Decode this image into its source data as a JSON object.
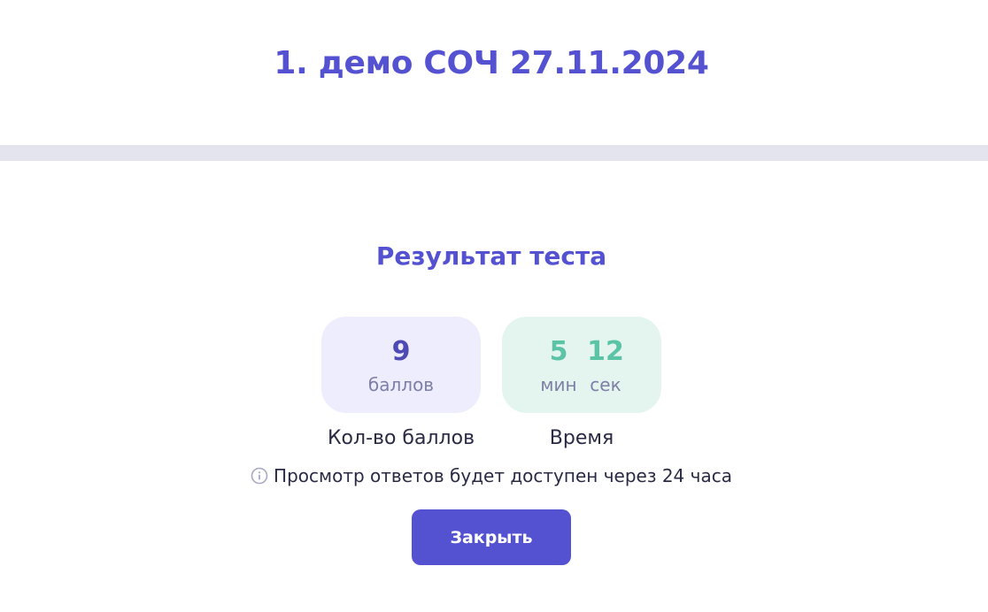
{
  "header": {
    "title": "1. демо СОЧ 27.11.2024"
  },
  "result": {
    "title": "Результат теста",
    "score": {
      "value": "9",
      "unit": "баллов",
      "caption": "Кол-во баллов"
    },
    "time": {
      "minutes": "5",
      "minutes_unit": "мин",
      "seconds": "12",
      "seconds_unit": "сек",
      "caption": "Время"
    },
    "notice": {
      "icon": "info-icon",
      "text": "Просмотр ответов будет доступен через 24 часа"
    },
    "close_label": "Закрыть"
  },
  "colors": {
    "accent": "#5552d1",
    "score_card_bg": "#eeedfd",
    "time_card_bg": "#e3f5ee",
    "time_value": "#5bc3a6",
    "divider": "#e4e4ee"
  }
}
